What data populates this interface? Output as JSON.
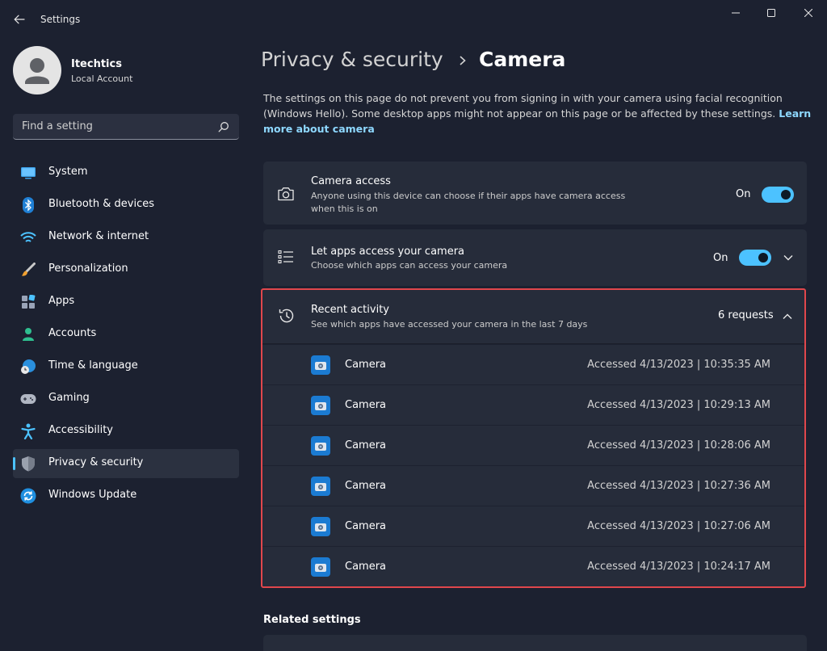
{
  "window": {
    "title": "Settings"
  },
  "profile": {
    "name": "Itechtics",
    "account_type": "Local Account"
  },
  "search": {
    "placeholder": "Find a setting"
  },
  "sidebar": {
    "items": [
      {
        "label": "System",
        "icon": "monitor-icon"
      },
      {
        "label": "Bluetooth & devices",
        "icon": "bluetooth-icon"
      },
      {
        "label": "Network & internet",
        "icon": "wifi-icon"
      },
      {
        "label": "Personalization",
        "icon": "paintbrush-icon"
      },
      {
        "label": "Apps",
        "icon": "apps-icon"
      },
      {
        "label": "Accounts",
        "icon": "person-icon"
      },
      {
        "label": "Time & language",
        "icon": "globe-clock-icon"
      },
      {
        "label": "Gaming",
        "icon": "gamepad-icon"
      },
      {
        "label": "Accessibility",
        "icon": "accessibility-icon"
      },
      {
        "label": "Privacy & security",
        "icon": "shield-icon",
        "selected": true
      },
      {
        "label": "Windows Update",
        "icon": "update-icon"
      }
    ]
  },
  "breadcrumb": {
    "parent": "Privacy & security",
    "current": "Camera"
  },
  "description": {
    "text": "The settings on this page do not prevent you from signing in with your camera using facial recognition (Windows Hello). Some desktop apps might not appear on this page or be affected by these settings.",
    "link": "Learn more about camera"
  },
  "camera_access": {
    "title": "Camera access",
    "subtitle": "Anyone using this device can choose if their apps have camera access when this is on",
    "state": "On"
  },
  "app_access": {
    "title": "Let apps access your camera",
    "subtitle": "Choose which apps can access your camera",
    "state": "On"
  },
  "recent_activity": {
    "title": "Recent activity",
    "subtitle": "See which apps have accessed your camera in the last 7 days",
    "count": "6 requests",
    "rows": [
      {
        "app": "Camera",
        "time": "Accessed 4/13/2023  |  10:35:35 AM"
      },
      {
        "app": "Camera",
        "time": "Accessed 4/13/2023  |  10:29:13 AM"
      },
      {
        "app": "Camera",
        "time": "Accessed 4/13/2023  |  10:28:06 AM"
      },
      {
        "app": "Camera",
        "time": "Accessed 4/13/2023  |  10:27:36 AM"
      },
      {
        "app": "Camera",
        "time": "Accessed 4/13/2023  |  10:27:06 AM"
      },
      {
        "app": "Camera",
        "time": "Accessed 4/13/2023  |  10:24:17 AM"
      }
    ]
  },
  "related": {
    "heading": "Related settings"
  },
  "colors": {
    "accent": "#4cc2ff",
    "highlight_border": "#e0474c",
    "background": "#1c2130",
    "card": "#262c3a"
  }
}
